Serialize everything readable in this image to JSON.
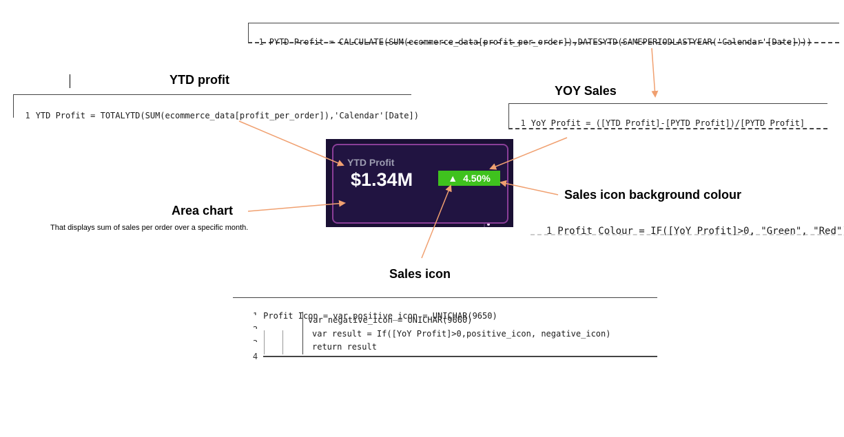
{
  "code_pytd": {
    "line_number": "1",
    "text": "PYTD Profit = CALCULATE(SUM(ecommerce_data[profit_per_order]),DATESYTD(SAMEPERIODLASTYEAR('Calendar'[Date])))"
  },
  "heading_ytd": "YTD profit",
  "code_ytd": {
    "line_number": "1",
    "text": "YTD Profit = TOTALYTD(SUM(ecommerce_data[profit_per_order]),'Calendar'[Date])"
  },
  "heading_yoy": "YOY Sales",
  "code_yoy": {
    "line_number": "1",
    "text": "YoY Profit = ([YTD Profit]-[PYTD Profit])/[PYTD Profit]"
  },
  "card": {
    "title": "YTD Profit",
    "value": "$1.34M",
    "badge_icon": "▲",
    "badge_value": "4.50%",
    "badge_color": "#3fc21e",
    "background": "#1a1034",
    "area_color": "#7b2f8f"
  },
  "heading_area": "Area chart",
  "area_note": "That displays sum of sales per order over a specific month.",
  "heading_bg": "Sales icon background colour",
  "code_colour": {
    "line_number": "1",
    "text": "Profit Colour = IF([YoY Profit]>0, \"Green\", \"Red\")"
  },
  "heading_icon": "Sales icon",
  "code_icon": {
    "lines": [
      {
        "n": "1",
        "text": "Profit Icon = var positive_icon = UNICHAR(9650)"
      },
      {
        "n": "2",
        "text": "var negative_icon = UNICHAR(9660)"
      },
      {
        "n": "3",
        "text": "var result = If([YoY Profit]>0,positive_icon, negative_icon)"
      },
      {
        "n": "4",
        "text": "return result"
      }
    ]
  },
  "colors": {
    "arrow": "#f0a070"
  }
}
